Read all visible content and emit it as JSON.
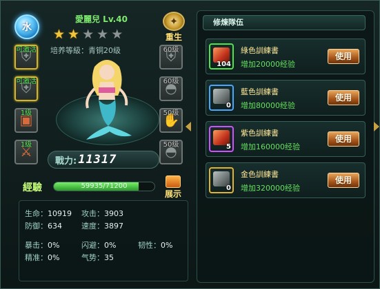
{
  "hero": {
    "element": "水",
    "name": "愛麗兒 Lv.40",
    "stars_total": 5,
    "stars_filled": 2,
    "cultivation": "培养等級：青铜20级",
    "rebirth_label": "重生",
    "show_label": "展示",
    "power_label": "戰力:",
    "power_value": "11317",
    "exp_label": "經驗",
    "exp_text": "59935/71200",
    "exp_fraction": 0.8418
  },
  "left_slots": [
    {
      "tag": "可激活",
      "style": "gold",
      "icon": "armor-icon"
    },
    {
      "tag": "可激活",
      "style": "gold",
      "icon": "armor-icon"
    },
    {
      "tag": "1级",
      "style": "item",
      "icon": "chest-icon"
    },
    {
      "tag": "1级",
      "style": "item",
      "icon": "sword-icon"
    }
  ],
  "right_slots": [
    {
      "tag": "60级",
      "icon": "armor-icon"
    },
    {
      "tag": "60级",
      "icon": "helmet-icon"
    },
    {
      "tag": "50级",
      "icon": "gauntlet-icon"
    },
    {
      "tag": "50级",
      "icon": "helmet-icon"
    }
  ],
  "stats": {
    "hp": {
      "k": "生命：",
      "v": "10919"
    },
    "atk": {
      "k": "攻击：",
      "v": "3903"
    },
    "def": {
      "k": "防御：",
      "v": "634"
    },
    "spd": {
      "k": "速度：",
      "v": "3897"
    },
    "crit": {
      "k": "暴击：",
      "v": "0%"
    },
    "dodge": {
      "k": "闪避：",
      "v": "0%"
    },
    "tough": {
      "k": "韧性：",
      "v": "0%"
    },
    "acc": {
      "k": "精准：",
      "v": "0%"
    },
    "mom": {
      "k": "气势：",
      "v": "35"
    }
  },
  "panel": {
    "title": "修煉隊伍",
    "books": [
      {
        "name": "綠色訓練書",
        "desc": "增加20000经验",
        "count": "104",
        "rarity": "green",
        "pic": "red",
        "button": "使用"
      },
      {
        "name": "藍色訓練書",
        "desc": "增加80000经验",
        "count": "0",
        "rarity": "blue",
        "pic": "gray",
        "button": "使用"
      },
      {
        "name": "紫色訓練書",
        "desc": "增加160000经验",
        "count": "5",
        "rarity": "purple",
        "pic": "red",
        "button": "使用"
      },
      {
        "name": "金色訓練書",
        "desc": "增加320000经验",
        "count": "0",
        "rarity": "gold",
        "pic": "gray",
        "button": "使用"
      }
    ]
  }
}
